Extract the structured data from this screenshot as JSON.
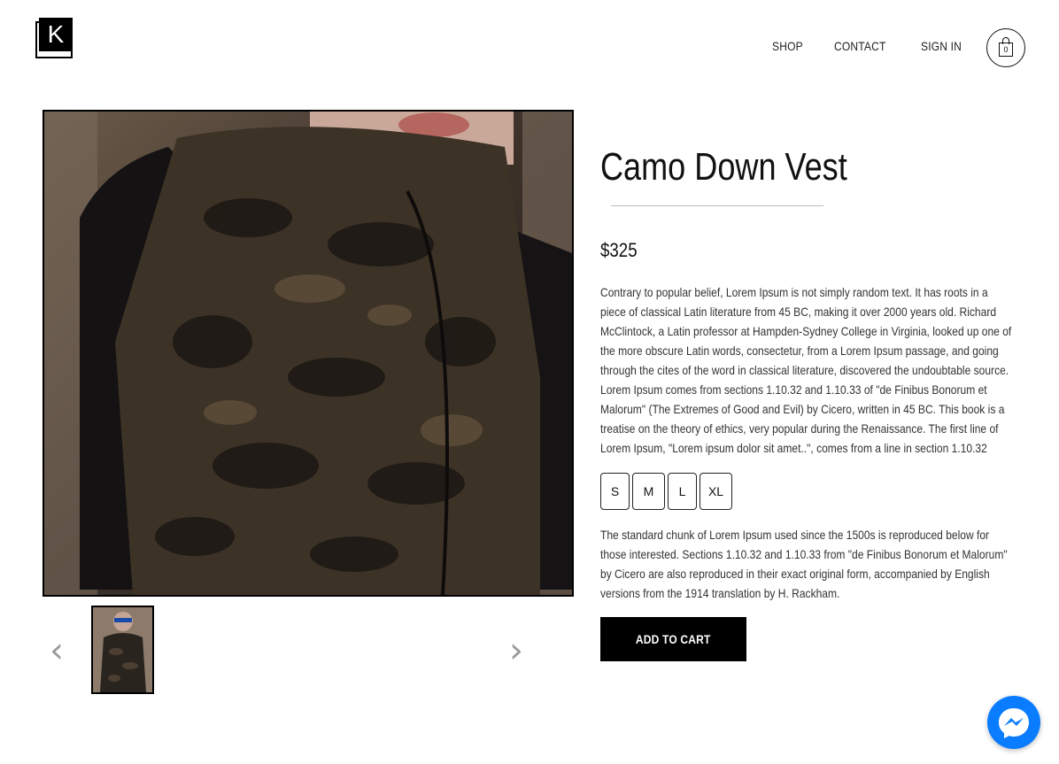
{
  "header": {
    "logo_letter": "K",
    "nav": [
      "SHOP",
      "CONTACT",
      "SIGN IN"
    ],
    "cart_count": "0"
  },
  "product": {
    "title": "Camo Down Vest",
    "price": "$325",
    "description": "Contrary to popular belief, Lorem Ipsum is not simply random text. It has roots in a piece of classical Latin literature from 45 BC, making it over 2000 years old. Richard McClintock, a Latin professor at Hampden-Sydney College in Virginia, looked up one of the more obscure Latin words, consectetur, from a Lorem Ipsum passage, and going through the cites of the word in classical literature, discovered the undoubtable source. Lorem Ipsum comes from sections 1.10.32 and 1.10.33 of \"de Finibus Bonorum et Malorum\" (The Extremes of Good and Evil) by Cicero, written in 45 BC. This book is a treatise on the theory of ethics, very popular during the Renaissance. The first line of Lorem Ipsum, \"Lorem ipsum dolor sit amet..\", comes from a line in section 1.10.32",
    "sizes": [
      "S",
      "M",
      "L",
      "XL"
    ],
    "details": "The standard chunk of Lorem Ipsum used since the 1500s is reproduced below for those interested. Sections 1.10.32 and 1.10.33 from \"de Finibus Bonorum et Malorum\" by Cicero are also reproduced in their exact original form, accompanied by English versions from the 1914 translation by H. Rackham.",
    "add_to_cart": "ADD TO CART"
  },
  "gallery": {
    "prev_icon": "‹",
    "next_icon": "›"
  },
  "colors": {
    "accent": "#000000",
    "messenger": "#0a7cff"
  }
}
